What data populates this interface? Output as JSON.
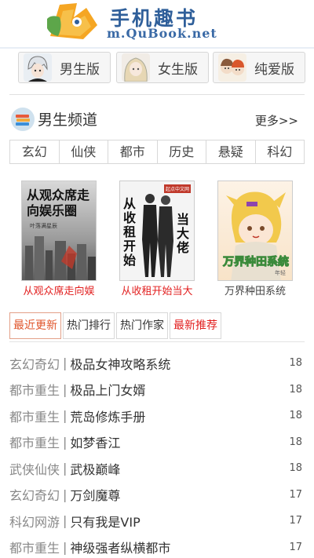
{
  "header": {
    "title": "手机趣书",
    "url": "m.QuBook.net"
  },
  "versions": [
    {
      "label": "男生版"
    },
    {
      "label": "女生版"
    },
    {
      "label": "纯爱版"
    }
  ],
  "channel": {
    "title": "男生频道",
    "more": "更多>>",
    "categories": [
      "玄幻",
      "仙侠",
      "都市",
      "历史",
      "悬疑",
      "科幻"
    ]
  },
  "books": [
    {
      "title": "从观众席走向娱",
      "cover_text": "从观众席走向娱乐圈",
      "cover_sub": "叶落满星辰",
      "title_color": "red"
    },
    {
      "title": "从收租开始当大",
      "cover_text_1": "从收租开始",
      "cover_text_2": "当大佬",
      "cover_tag": "起点中文网",
      "title_color": "red"
    },
    {
      "title": "万界种田系统",
      "cover_text": "万界种田系统",
      "cover_sub": "年轻",
      "title_color": "dark"
    }
  ],
  "tabs": [
    {
      "label": "最近更新",
      "state": "active"
    },
    {
      "label": "热门排行",
      "state": "normal"
    },
    {
      "label": "热门作家",
      "state": "normal"
    },
    {
      "label": "最新推荐",
      "state": "red"
    }
  ],
  "updates": [
    {
      "genre": "玄幻奇幻",
      "title": "极品女神攻略系统",
      "date": "18"
    },
    {
      "genre": "都市重生",
      "title": "极品上门女婿",
      "date": "18"
    },
    {
      "genre": "都市重生",
      "title": "荒岛修炼手册",
      "date": "18"
    },
    {
      "genre": "都市重生",
      "title": "如梦香江",
      "date": "18"
    },
    {
      "genre": "武侠仙侠",
      "title": "武极巅峰",
      "date": "18"
    },
    {
      "genre": "玄幻奇幻",
      "title": "万剑魔尊",
      "date": "17"
    },
    {
      "genre": "科幻网游",
      "title": "只有我是VIP",
      "date": "17"
    },
    {
      "genre": "都市重生",
      "title": "神级强者纵横都市",
      "date": "17"
    }
  ],
  "separator": "|",
  "colors": {
    "brand": "#2f5f9a",
    "accent_red": "#e21f1f",
    "tab_active": "#e0552b"
  }
}
